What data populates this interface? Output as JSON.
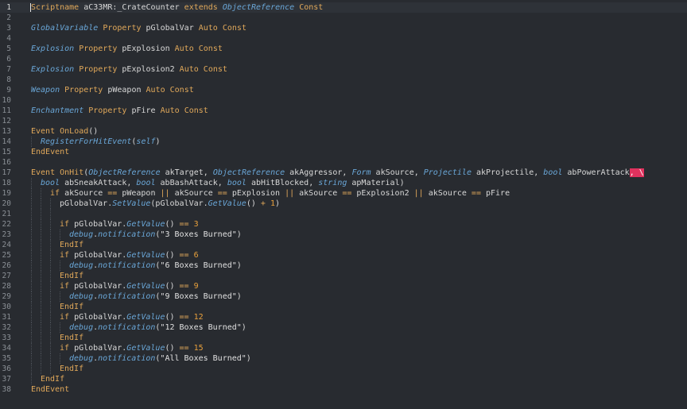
{
  "editor": {
    "active_line": 1,
    "lines": [
      {
        "n": "1",
        "indent": 0,
        "tokens": [
          [
            "k",
            "Scriptname"
          ],
          [
            "v",
            " aC33MR:_CrateCounter "
          ],
          [
            "k",
            "extends"
          ],
          [
            "v",
            " "
          ],
          [
            "t",
            "ObjectReference"
          ],
          [
            "v",
            " "
          ],
          [
            "k",
            "Const"
          ]
        ]
      },
      {
        "n": "2",
        "indent": 0,
        "tokens": []
      },
      {
        "n": "3",
        "indent": 0,
        "tokens": [
          [
            "t",
            "GlobalVariable"
          ],
          [
            "v",
            " "
          ],
          [
            "k",
            "Property"
          ],
          [
            "v",
            " pGlobalVar "
          ],
          [
            "k",
            "Auto"
          ],
          [
            "v",
            " "
          ],
          [
            "k",
            "Const"
          ]
        ]
      },
      {
        "n": "4",
        "indent": 0,
        "tokens": []
      },
      {
        "n": "5",
        "indent": 0,
        "tokens": [
          [
            "t",
            "Explosion"
          ],
          [
            "v",
            " "
          ],
          [
            "k",
            "Property"
          ],
          [
            "v",
            " pExplosion "
          ],
          [
            "k",
            "Auto"
          ],
          [
            "v",
            " "
          ],
          [
            "k",
            "Const"
          ]
        ]
      },
      {
        "n": "6",
        "indent": 0,
        "tokens": []
      },
      {
        "n": "7",
        "indent": 0,
        "tokens": [
          [
            "t",
            "Explosion"
          ],
          [
            "v",
            " "
          ],
          [
            "k",
            "Property"
          ],
          [
            "v",
            " pExplosion2 "
          ],
          [
            "k",
            "Auto"
          ],
          [
            "v",
            " "
          ],
          [
            "k",
            "Const"
          ]
        ]
      },
      {
        "n": "8",
        "indent": 0,
        "tokens": []
      },
      {
        "n": "9",
        "indent": 0,
        "tokens": [
          [
            "t",
            "Weapon"
          ],
          [
            "v",
            " "
          ],
          [
            "k",
            "Property"
          ],
          [
            "v",
            " pWeapon "
          ],
          [
            "k",
            "Auto"
          ],
          [
            "v",
            " "
          ],
          [
            "k",
            "Const"
          ]
        ]
      },
      {
        "n": "10",
        "indent": 0,
        "tokens": []
      },
      {
        "n": "11",
        "indent": 0,
        "tokens": [
          [
            "t",
            "Enchantment"
          ],
          [
            "v",
            " "
          ],
          [
            "k",
            "Property"
          ],
          [
            "v",
            " pFire "
          ],
          [
            "k",
            "Auto"
          ],
          [
            "v",
            " "
          ],
          [
            "k",
            "Const"
          ]
        ]
      },
      {
        "n": "12",
        "indent": 0,
        "tokens": []
      },
      {
        "n": "13",
        "indent": 0,
        "tokens": [
          [
            "k",
            "Event"
          ],
          [
            "v",
            " "
          ],
          [
            "e",
            "OnLoad"
          ],
          [
            "v",
            "()"
          ]
        ]
      },
      {
        "n": "14",
        "indent": 1,
        "tokens": [
          [
            "f",
            "RegisterForHitEvent"
          ],
          [
            "v",
            "("
          ],
          [
            "t",
            "self"
          ],
          [
            "v",
            ")"
          ]
        ]
      },
      {
        "n": "15",
        "indent": 0,
        "tokens": [
          [
            "k",
            "EndEvent"
          ]
        ]
      },
      {
        "n": "16",
        "indent": 0,
        "tokens": []
      },
      {
        "n": "17",
        "indent": 0,
        "tokens": [
          [
            "k",
            "Event"
          ],
          [
            "v",
            " "
          ],
          [
            "e",
            "OnHit"
          ],
          [
            "v",
            "("
          ],
          [
            "t",
            "ObjectReference"
          ],
          [
            "v",
            " akTarget, "
          ],
          [
            "t",
            "ObjectReference"
          ],
          [
            "v",
            " akAggressor, "
          ],
          [
            "t",
            "Form"
          ],
          [
            "v",
            " akSource, "
          ],
          [
            "t",
            "Projectile"
          ],
          [
            "v",
            " akProjectile, "
          ],
          [
            "t",
            "bool"
          ],
          [
            "v",
            " abPowerAttack"
          ],
          [
            "err",
            ", \\"
          ]
        ]
      },
      {
        "n": "18",
        "indent": 1,
        "tokens": [
          [
            "t",
            "bool"
          ],
          [
            "v",
            " abSneakAttack, "
          ],
          [
            "t",
            "bool"
          ],
          [
            "v",
            " abBashAttack, "
          ],
          [
            "t",
            "bool"
          ],
          [
            "v",
            " abHitBlocked, "
          ],
          [
            "t",
            "string"
          ],
          [
            "v",
            " apMaterial)"
          ]
        ]
      },
      {
        "n": "19",
        "indent": 2,
        "tokens": [
          [
            "k",
            "if"
          ],
          [
            "v",
            " akSource "
          ],
          [
            "o",
            "=="
          ],
          [
            "v",
            " pWeapon "
          ],
          [
            "o",
            "||"
          ],
          [
            "v",
            " akSource "
          ],
          [
            "o",
            "=="
          ],
          [
            "v",
            " pExplosion "
          ],
          [
            "o",
            "||"
          ],
          [
            "v",
            " akSource "
          ],
          [
            "o",
            "=="
          ],
          [
            "v",
            " pExplosion2 "
          ],
          [
            "o",
            "||"
          ],
          [
            "v",
            " akSource "
          ],
          [
            "o",
            "=="
          ],
          [
            "v",
            " pFire"
          ]
        ]
      },
      {
        "n": "20",
        "indent": 3,
        "tokens": [
          [
            "v",
            "pGlobalVar."
          ],
          [
            "f",
            "SetValue"
          ],
          [
            "v",
            "(pGlobalVar."
          ],
          [
            "f",
            "GetValue"
          ],
          [
            "v",
            "() "
          ],
          [
            "o",
            "+"
          ],
          [
            "v",
            " "
          ],
          [
            "n",
            "1"
          ],
          [
            "v",
            ")"
          ]
        ]
      },
      {
        "n": "21",
        "indent": 3,
        "tokens": []
      },
      {
        "n": "22",
        "indent": 3,
        "tokens": [
          [
            "k",
            "if"
          ],
          [
            "v",
            " pGlobalVar."
          ],
          [
            "f",
            "GetValue"
          ],
          [
            "v",
            "() "
          ],
          [
            "o",
            "=="
          ],
          [
            "v",
            " "
          ],
          [
            "n",
            "3"
          ]
        ]
      },
      {
        "n": "23",
        "indent": 4,
        "tokens": [
          [
            "f",
            "debug"
          ],
          [
            "v",
            "."
          ],
          [
            "f",
            "notification"
          ],
          [
            "v",
            "("
          ],
          [
            "s",
            "\"3 Boxes Burned\""
          ],
          [
            "v",
            ")"
          ]
        ]
      },
      {
        "n": "24",
        "indent": 3,
        "tokens": [
          [
            "k",
            "EndIf"
          ]
        ]
      },
      {
        "n": "25",
        "indent": 3,
        "tokens": [
          [
            "k",
            "if"
          ],
          [
            "v",
            " pGlobalVar."
          ],
          [
            "f",
            "GetValue"
          ],
          [
            "v",
            "() "
          ],
          [
            "o",
            "=="
          ],
          [
            "v",
            " "
          ],
          [
            "n",
            "6"
          ]
        ]
      },
      {
        "n": "26",
        "indent": 4,
        "tokens": [
          [
            "f",
            "debug"
          ],
          [
            "v",
            "."
          ],
          [
            "f",
            "notification"
          ],
          [
            "v",
            "("
          ],
          [
            "s",
            "\"6 Boxes Burned\""
          ],
          [
            "v",
            ")"
          ]
        ]
      },
      {
        "n": "27",
        "indent": 3,
        "tokens": [
          [
            "k",
            "EndIf"
          ]
        ]
      },
      {
        "n": "28",
        "indent": 3,
        "tokens": [
          [
            "k",
            "if"
          ],
          [
            "v",
            " pGlobalVar."
          ],
          [
            "f",
            "GetValue"
          ],
          [
            "v",
            "() "
          ],
          [
            "o",
            "=="
          ],
          [
            "v",
            " "
          ],
          [
            "n",
            "9"
          ]
        ]
      },
      {
        "n": "29",
        "indent": 4,
        "tokens": [
          [
            "f",
            "debug"
          ],
          [
            "v",
            "."
          ],
          [
            "f",
            "notification"
          ],
          [
            "v",
            "("
          ],
          [
            "s",
            "\"9 Boxes Burned\""
          ],
          [
            "v",
            ")"
          ]
        ]
      },
      {
        "n": "30",
        "indent": 3,
        "tokens": [
          [
            "k",
            "EndIf"
          ]
        ]
      },
      {
        "n": "31",
        "indent": 3,
        "tokens": [
          [
            "k",
            "if"
          ],
          [
            "v",
            " pGlobalVar."
          ],
          [
            "f",
            "GetValue"
          ],
          [
            "v",
            "() "
          ],
          [
            "o",
            "=="
          ],
          [
            "v",
            " "
          ],
          [
            "n",
            "12"
          ]
        ]
      },
      {
        "n": "32",
        "indent": 4,
        "tokens": [
          [
            "f",
            "debug"
          ],
          [
            "v",
            "."
          ],
          [
            "f",
            "notification"
          ],
          [
            "v",
            "("
          ],
          [
            "s",
            "\"12 Boxes Burned\""
          ],
          [
            "v",
            ")"
          ]
        ]
      },
      {
        "n": "33",
        "indent": 3,
        "tokens": [
          [
            "k",
            "EndIf"
          ]
        ]
      },
      {
        "n": "34",
        "indent": 3,
        "tokens": [
          [
            "k",
            "if"
          ],
          [
            "v",
            " pGlobalVar."
          ],
          [
            "f",
            "GetValue"
          ],
          [
            "v",
            "() "
          ],
          [
            "o",
            "=="
          ],
          [
            "v",
            " "
          ],
          [
            "n",
            "15"
          ]
        ]
      },
      {
        "n": "35",
        "indent": 4,
        "tokens": [
          [
            "f",
            "debug"
          ],
          [
            "v",
            "."
          ],
          [
            "f",
            "notification"
          ],
          [
            "v",
            "("
          ],
          [
            "s",
            "\"All Boxes Burned\""
          ],
          [
            "v",
            ")"
          ]
        ]
      },
      {
        "n": "36",
        "indent": 3,
        "tokens": [
          [
            "k",
            "EndIf"
          ]
        ]
      },
      {
        "n": "37",
        "indent": 1,
        "tokens": [
          [
            "k",
            "EndIf"
          ]
        ]
      },
      {
        "n": "38",
        "indent": 0,
        "tokens": [
          [
            "k",
            "EndEvent"
          ]
        ]
      }
    ],
    "colors": {
      "background": "#282b30",
      "keyword": "#e0a85a",
      "type": "#6aa7d8",
      "number": "#e8a03c",
      "error_highlight": "#e0325e"
    }
  }
}
